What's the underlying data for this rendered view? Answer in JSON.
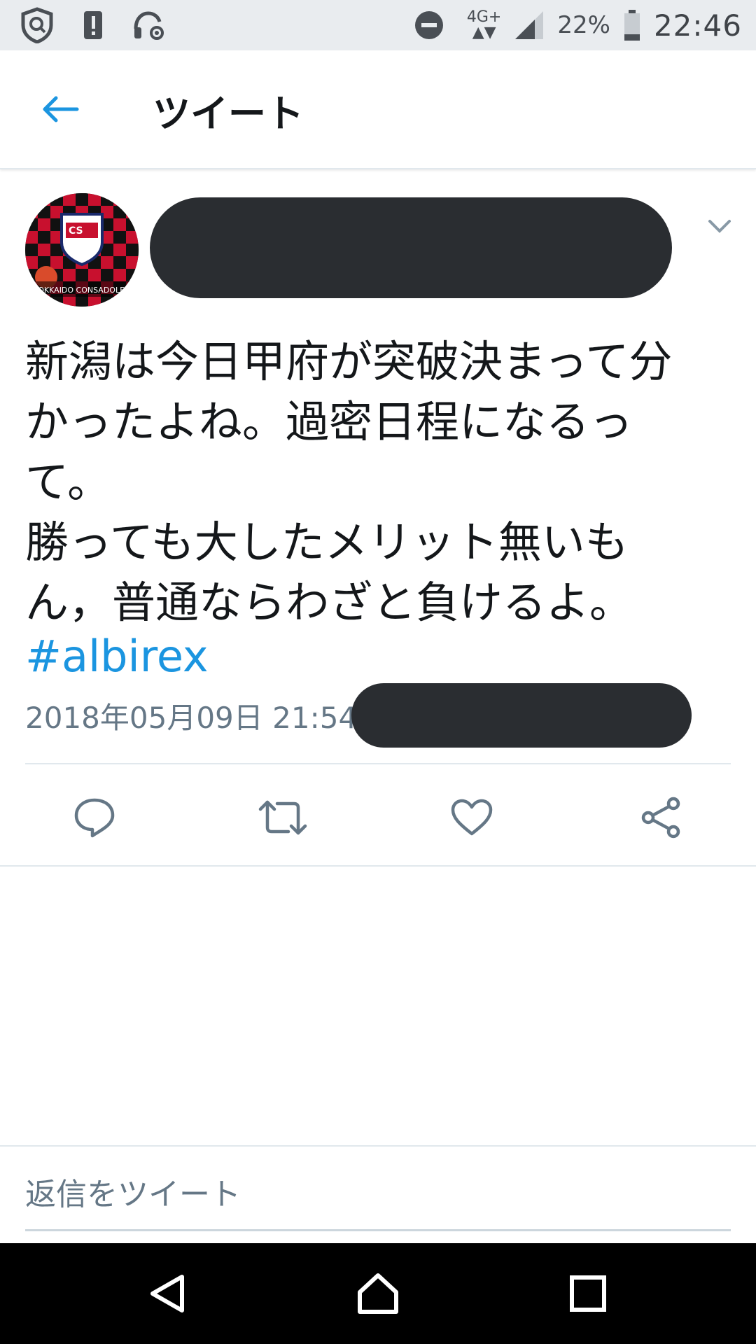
{
  "status_bar": {
    "network": "4G+",
    "battery_percent": "22%",
    "battery_level": 0.22,
    "time": "22:46",
    "icons": [
      "shield-icon",
      "alert-icon",
      "headset-settings-icon",
      "do-not-disturb-icon",
      "signal-icon",
      "battery-icon"
    ]
  },
  "header": {
    "title": "ツイート",
    "back_icon": "arrow-left-icon"
  },
  "tweet": {
    "avatar_text": "HOKKAIDO CONSADOLE SAPPORO",
    "avatar_badge": "CS",
    "text": "新潟は今日甲府が突破決まって分\nかったよね。過密日程になるっ\nて。\n勝っても大したメリット無いも\nん，普通ならわざと負けるよ。",
    "hashtag": "#albirex",
    "timestamp": "2018年05月09日 21:54",
    "more_icon": "chevron-down-icon"
  },
  "actions": [
    "reply-icon",
    "retweet-icon",
    "like-icon",
    "share-icon"
  ],
  "reply": {
    "placeholder": "返信をツイート"
  },
  "colors": {
    "accent": "#1b95e0",
    "muted": "#657786",
    "divider": "#e1e8ed",
    "redaction": "#2a2d31"
  },
  "navbar": [
    "back-nav-icon",
    "home-nav-icon",
    "recents-nav-icon"
  ]
}
